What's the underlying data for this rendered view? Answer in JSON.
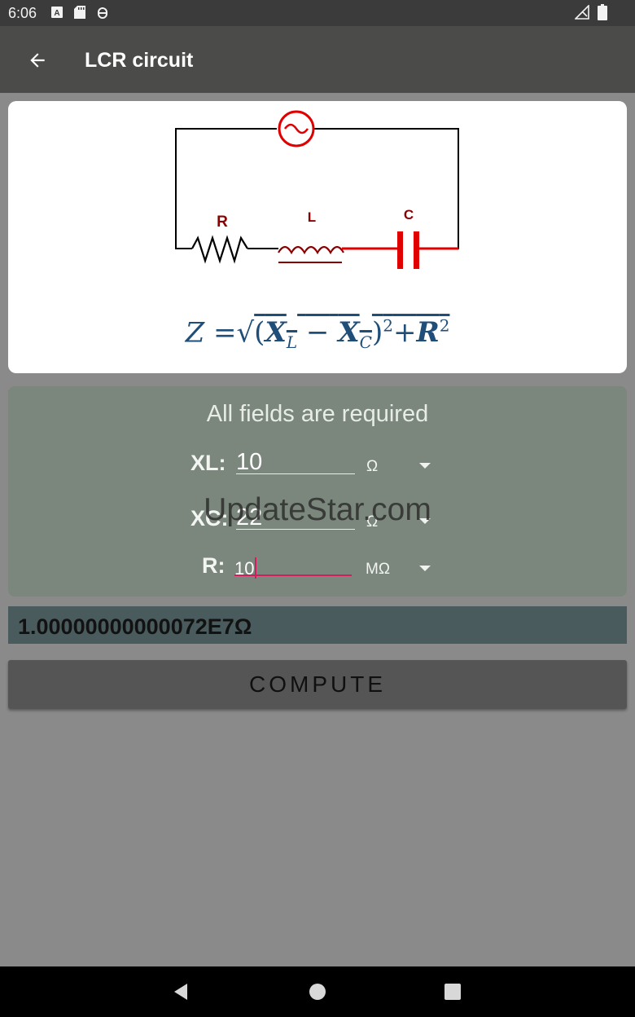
{
  "status_bar": {
    "time": "6:06",
    "icons": [
      "a-icon",
      "sd-card-icon",
      "bug-icon"
    ],
    "right_icons": [
      "signal-icon",
      "battery-icon"
    ]
  },
  "app_bar": {
    "title": "LCR circuit",
    "back_icon": "arrow-left-icon"
  },
  "diagram": {
    "labels": {
      "r": "R",
      "l": "L",
      "c": "C"
    },
    "colors": {
      "wire": "#000000",
      "component": "#e00000",
      "label": "#8b0000"
    }
  },
  "formula": {
    "z": "Z",
    "eq": "=",
    "sqrt": "√",
    "open": "(",
    "xl": "X",
    "xl_sub": "L",
    "minus": "−",
    "xc": "X",
    "xc_sub": "C",
    "close": ")",
    "sq1": "2",
    "plus": "+",
    "r": "R",
    "sq2": "2"
  },
  "form": {
    "heading": "All fields are required",
    "xl": {
      "label": "XL:",
      "value": "10",
      "unit": "Ω"
    },
    "xc": {
      "label": "XC:",
      "value": "22",
      "unit": "Ω"
    },
    "r": {
      "label": "R:",
      "value": "10",
      "unit": "MΩ"
    }
  },
  "watermark": "UpdateStar.com",
  "result": "1.00000000000072E7Ω",
  "compute_label": "COMPUTE",
  "colors": {
    "status_bar": "#3b3b3b",
    "app_bar": "#4b4c4a",
    "background": "#8a8a8a",
    "input_card": "#7b867c",
    "result_bg": "#4a5b5e",
    "button": "#555555",
    "focus_line": "#d81b60"
  }
}
